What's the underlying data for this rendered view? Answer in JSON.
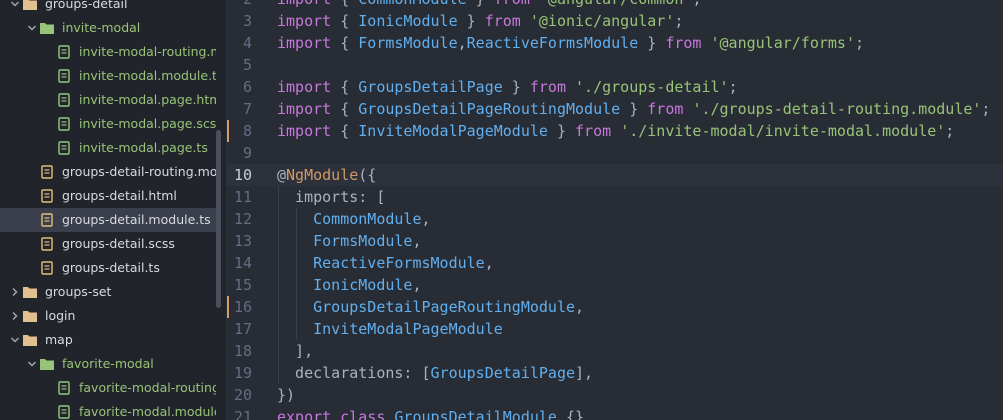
{
  "sidebar": {
    "items": [
      {
        "label": "groups-detail",
        "depth": 1,
        "kind": "folder",
        "expanded": true,
        "color": "white",
        "selected": false
      },
      {
        "label": "invite-modal",
        "depth": 2,
        "kind": "folder",
        "expanded": true,
        "color": "green",
        "selected": false
      },
      {
        "label": "invite-modal-routing.module.ts",
        "depth": 3,
        "kind": "file",
        "color": "green",
        "selected": false
      },
      {
        "label": "invite-modal.module.ts",
        "depth": 3,
        "kind": "file",
        "color": "green",
        "selected": false
      },
      {
        "label": "invite-modal.page.html",
        "depth": 3,
        "kind": "file",
        "color": "green",
        "selected": false
      },
      {
        "label": "invite-modal.page.scss",
        "depth": 3,
        "kind": "file",
        "color": "green",
        "selected": false
      },
      {
        "label": "invite-modal.page.ts",
        "depth": 3,
        "kind": "file",
        "color": "green",
        "selected": false
      },
      {
        "label": "groups-detail-routing.module.ts",
        "depth": 2,
        "kind": "file",
        "color": "white",
        "selected": false
      },
      {
        "label": "groups-detail.html",
        "depth": 2,
        "kind": "file",
        "color": "white",
        "selected": false
      },
      {
        "label": "groups-detail.module.ts",
        "depth": 2,
        "kind": "file",
        "color": "white",
        "selected": true
      },
      {
        "label": "groups-detail.scss",
        "depth": 2,
        "kind": "file",
        "color": "white",
        "selected": false
      },
      {
        "label": "groups-detail.ts",
        "depth": 2,
        "kind": "file",
        "color": "white",
        "selected": false
      },
      {
        "label": "groups-set",
        "depth": 1,
        "kind": "folder",
        "expanded": false,
        "color": "white",
        "selected": false
      },
      {
        "label": "login",
        "depth": 1,
        "kind": "folder",
        "expanded": false,
        "color": "white",
        "selected": false
      },
      {
        "label": "map",
        "depth": 1,
        "kind": "folder",
        "expanded": true,
        "color": "white",
        "selected": false
      },
      {
        "label": "favorite-modal",
        "depth": 2,
        "kind": "folder",
        "expanded": true,
        "color": "green",
        "selected": false
      },
      {
        "label": "favorite-modal-routing.module.ts",
        "depth": 3,
        "kind": "file",
        "color": "green",
        "selected": false
      },
      {
        "label": "favorite-modal.module.ts",
        "depth": 3,
        "kind": "file",
        "color": "green",
        "selected": false
      }
    ]
  },
  "editor": {
    "current_line": 10,
    "modified_lines": [
      8,
      16
    ],
    "lines": [
      {
        "n": "2",
        "tokens": [
          [
            "kw",
            "import"
          ],
          [
            "p",
            " { "
          ],
          [
            "cls",
            "CommonModule"
          ],
          [
            "p",
            " } "
          ],
          [
            "kw",
            "from"
          ],
          [
            "p",
            " "
          ],
          [
            "str",
            "'@angular/common'"
          ],
          [
            "p",
            ";"
          ]
        ]
      },
      {
        "n": "3",
        "tokens": [
          [
            "kw",
            "import"
          ],
          [
            "p",
            " { "
          ],
          [
            "cls",
            "IonicModule"
          ],
          [
            "p",
            " } "
          ],
          [
            "kw",
            "from"
          ],
          [
            "p",
            " "
          ],
          [
            "str",
            "'@ionic/angular'"
          ],
          [
            "p",
            ";"
          ]
        ]
      },
      {
        "n": "4",
        "tokens": [
          [
            "kw",
            "import"
          ],
          [
            "p",
            " { "
          ],
          [
            "cls",
            "FormsModule"
          ],
          [
            "p",
            ","
          ],
          [
            "cls",
            "ReactiveFormsModule"
          ],
          [
            "p",
            " } "
          ],
          [
            "kw",
            "from"
          ],
          [
            "p",
            " "
          ],
          [
            "str",
            "'@angular/forms'"
          ],
          [
            "p",
            ";"
          ]
        ]
      },
      {
        "n": "5",
        "tokens": []
      },
      {
        "n": "6",
        "tokens": [
          [
            "kw",
            "import"
          ],
          [
            "p",
            " { "
          ],
          [
            "cls",
            "GroupsDetailPage"
          ],
          [
            "p",
            " } "
          ],
          [
            "kw",
            "from"
          ],
          [
            "p",
            " "
          ],
          [
            "str",
            "'./groups-detail'"
          ],
          [
            "p",
            ";"
          ]
        ]
      },
      {
        "n": "7",
        "tokens": [
          [
            "kw",
            "import"
          ],
          [
            "p",
            " { "
          ],
          [
            "cls",
            "GroupsDetailPageRoutingModule"
          ],
          [
            "p",
            " } "
          ],
          [
            "kw",
            "from"
          ],
          [
            "p",
            " "
          ],
          [
            "str",
            "'./groups-detail-routing.module'"
          ],
          [
            "p",
            ";"
          ]
        ]
      },
      {
        "n": "8",
        "tokens": [
          [
            "kw",
            "import"
          ],
          [
            "p",
            " { "
          ],
          [
            "cls",
            "InviteModalPageModule"
          ],
          [
            "p",
            " } "
          ],
          [
            "kw",
            "from"
          ],
          [
            "p",
            " "
          ],
          [
            "str",
            "'./invite-modal/invite-modal.module'"
          ],
          [
            "p",
            ";"
          ]
        ]
      },
      {
        "n": "9",
        "tokens": []
      },
      {
        "n": "10",
        "tokens": [
          [
            "p",
            "@"
          ],
          [
            "dec",
            "NgModule"
          ],
          [
            "p",
            "({"
          ]
        ]
      },
      {
        "n": "11",
        "tokens": [
          [
            "p",
            "  imports: ["
          ]
        ]
      },
      {
        "n": "12",
        "tokens": [
          [
            "p",
            "    "
          ],
          [
            "cls",
            "CommonModule"
          ],
          [
            "p",
            ","
          ]
        ]
      },
      {
        "n": "13",
        "tokens": [
          [
            "p",
            "    "
          ],
          [
            "cls",
            "FormsModule"
          ],
          [
            "p",
            ","
          ]
        ]
      },
      {
        "n": "14",
        "tokens": [
          [
            "p",
            "    "
          ],
          [
            "cls",
            "ReactiveFormsModule"
          ],
          [
            "p",
            ","
          ]
        ]
      },
      {
        "n": "15",
        "tokens": [
          [
            "p",
            "    "
          ],
          [
            "cls",
            "IonicModule"
          ],
          [
            "p",
            ","
          ]
        ]
      },
      {
        "n": "16",
        "tokens": [
          [
            "p",
            "    "
          ],
          [
            "cls",
            "GroupsDetailPageRoutingModule"
          ],
          [
            "p",
            ","
          ]
        ]
      },
      {
        "n": "17",
        "tokens": [
          [
            "p",
            "    "
          ],
          [
            "cls",
            "InviteModalPageModule"
          ]
        ]
      },
      {
        "n": "18",
        "tokens": [
          [
            "p",
            "  ],"
          ]
        ]
      },
      {
        "n": "19",
        "tokens": [
          [
            "p",
            "  declarations: ["
          ],
          [
            "cls",
            "GroupsDetailPage"
          ],
          [
            "p",
            "],"
          ]
        ]
      },
      {
        "n": "20",
        "tokens": [
          [
            "p",
            "})"
          ]
        ]
      },
      {
        "n": "21",
        "tokens": [
          [
            "kw",
            "export"
          ],
          [
            "p",
            " "
          ],
          [
            "kw",
            "class"
          ],
          [
            "p",
            " "
          ],
          [
            "cls",
            "GroupsDetailModule"
          ],
          [
            "p",
            " {}"
          ]
        ]
      }
    ]
  },
  "colors": {
    "sidebar_bg": "#21252b",
    "editor_bg": "#282c34",
    "folder": "#e2c08d",
    "folder_green": "#98c379",
    "file_icon": "#e5c07b",
    "selected_row": "#3a3f4b",
    "keyword": "#c678dd",
    "class": "#61afef",
    "string": "#98c379",
    "decorator": "#d19a66"
  }
}
